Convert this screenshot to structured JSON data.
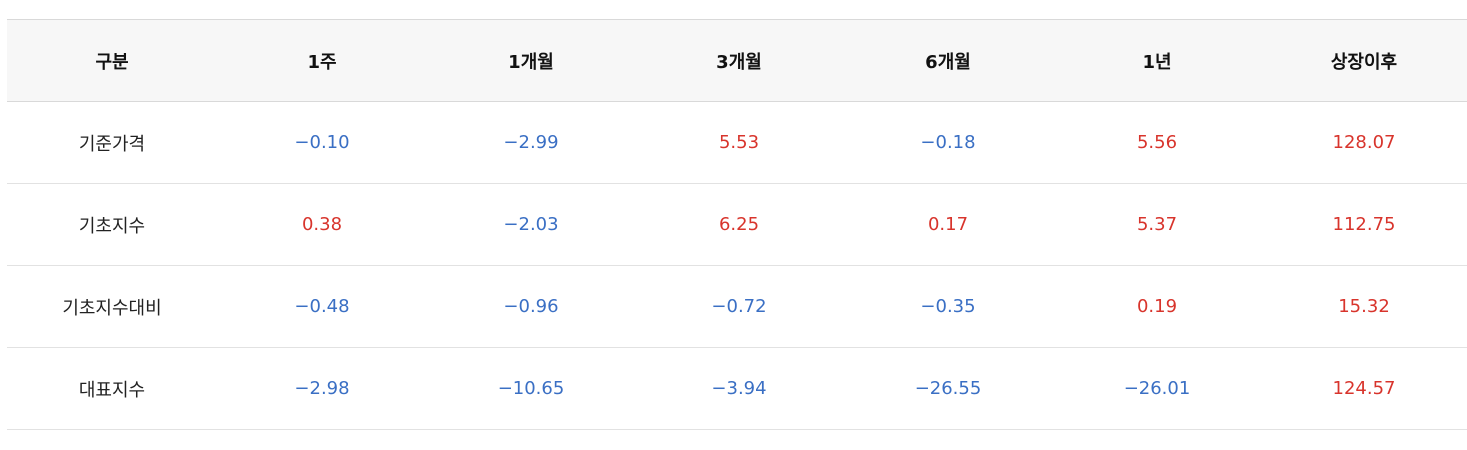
{
  "colors": {
    "negative": "#3a6fc4",
    "positive": "#d8342c",
    "header_bg": "#f7f7f7"
  },
  "table": {
    "headers": [
      "구분",
      "1주",
      "1개월",
      "3개월",
      "6개월",
      "1년",
      "상장이후"
    ],
    "rows": [
      {
        "label": "기준가격",
        "values": [
          "−0.10",
          "−2.99",
          "5.53",
          "−0.18",
          "5.56",
          "128.07"
        ]
      },
      {
        "label": "기초지수",
        "values": [
          "0.38",
          "−2.03",
          "6.25",
          "0.17",
          "5.37",
          "112.75"
        ]
      },
      {
        "label": "기초지수대비",
        "values": [
          "−0.48",
          "−0.96",
          "−0.72",
          "−0.35",
          "0.19",
          "15.32"
        ]
      },
      {
        "label": "대표지수",
        "values": [
          "−2.98",
          "−10.65",
          "−3.94",
          "−26.55",
          "−26.01",
          "124.57"
        ]
      }
    ]
  }
}
